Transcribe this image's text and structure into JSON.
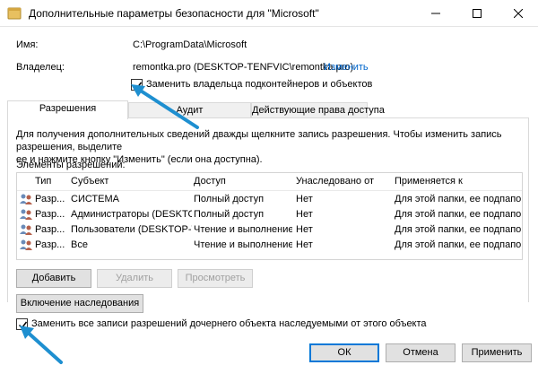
{
  "window": {
    "title": "Дополнительные параметры безопасности  для \"Microsoft\""
  },
  "info": {
    "name_label": "Имя:",
    "name_value": "C:\\ProgramData\\Microsoft",
    "owner_label": "Владелец:",
    "owner_value": "remontka.pro (DESKTOP-TENFVIC\\remontka.pro)",
    "change_link": "Изменить",
    "replace_owner_label": "Заменить владельца подконтейнеров и объектов",
    "replace_owner_checked": true
  },
  "tabs": [
    {
      "label": "Разрешения",
      "active": true
    },
    {
      "label": "Аудит",
      "active": false
    },
    {
      "label": "Действующие права доступа",
      "active": false
    }
  ],
  "permissions": {
    "description_line1": "Для получения дополнительных сведений дважды щелкните запись разрешения. Чтобы изменить запись разрешения, выделите",
    "description_line2": "ее и нажмите кнопку \"Изменить\" (если она доступна).",
    "section_title": "Элементы разрешений:",
    "columns": [
      "Тип",
      "Субъект",
      "Доступ",
      "Унаследовано от",
      "Применяется к"
    ],
    "rows": [
      {
        "type": "Разр...",
        "subject": "СИСТЕМА",
        "access": "Полный доступ",
        "inherited": "Нет",
        "applies": "Для этой папки, ее подпапок ..."
      },
      {
        "type": "Разр...",
        "subject": "Администраторы (DESKTOP-...",
        "access": "Полный доступ",
        "inherited": "Нет",
        "applies": "Для этой папки, ее подпапок ..."
      },
      {
        "type": "Разр...",
        "subject": "Пользователи (DESKTOP-TE...",
        "access": "Чтение и выполнение",
        "inherited": "Нет",
        "applies": "Для этой папки, ее подпапок ..."
      },
      {
        "type": "Разр...",
        "subject": "Все",
        "access": "Чтение и выполнение",
        "inherited": "Нет",
        "applies": "Для этой папки, ее подпапок ..."
      }
    ]
  },
  "buttons": {
    "add": "Добавить",
    "remove": "Удалить",
    "view": "Просмотреть",
    "enable_inheritance": "Включение наследования",
    "ok": "ОК",
    "cancel": "Отмена",
    "apply": "Применить"
  },
  "replace_child": {
    "label": "Заменить все записи разрешений дочернего объекта наследуемыми от этого объекта",
    "checked": true
  },
  "icons": {
    "title": "security-shield-icon",
    "user": "user-group-icon",
    "arrow": "arrow-pointer"
  },
  "colors": {
    "link": "#0066cc",
    "arrow": "#1e8fd0",
    "primary_border": "#0078d7"
  }
}
